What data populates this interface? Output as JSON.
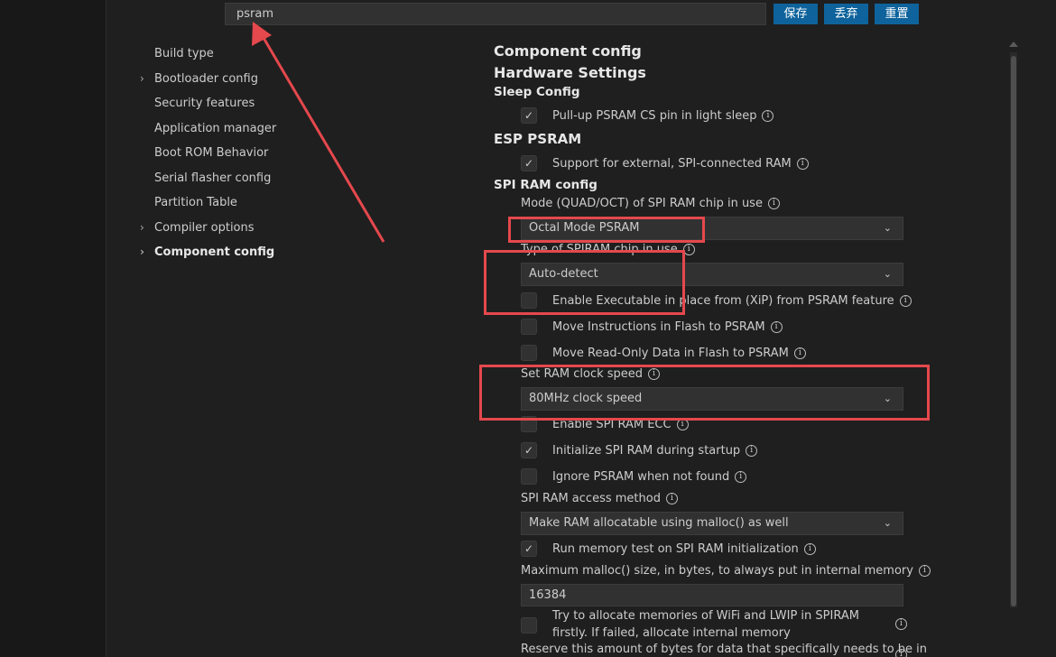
{
  "search": {
    "value": "psram"
  },
  "toolbar": {
    "save_label": "保存",
    "discard_label": "丢弃",
    "reset_label": "重置"
  },
  "nav": {
    "items": [
      {
        "label": "Build type",
        "expandable": false
      },
      {
        "label": "Bootloader config",
        "expandable": true
      },
      {
        "label": "Security features",
        "expandable": false
      },
      {
        "label": "Application manager",
        "expandable": false
      },
      {
        "label": "Boot ROM Behavior",
        "expandable": false
      },
      {
        "label": "Serial flasher config",
        "expandable": false
      },
      {
        "label": "Partition Table",
        "expandable": false
      },
      {
        "label": "Compiler options",
        "expandable": true
      },
      {
        "label": "Component config",
        "expandable": true,
        "active": true
      }
    ]
  },
  "content": {
    "component_config": "Component config",
    "hardware_settings": "Hardware Settings",
    "sleep_config": "Sleep Config",
    "pullup_cs": {
      "label": "Pull-up PSRAM CS pin in light sleep",
      "checked": true
    },
    "esp_psram": "ESP PSRAM",
    "support_external": {
      "label": "Support for external, SPI-connected RAM",
      "checked": true
    },
    "spi_ram_config": "SPI RAM config",
    "mode_label": "Mode (QUAD/OCT) of SPI RAM chip in use",
    "mode_value": "Octal Mode PSRAM",
    "type_label": "Type of SPIRAM chip in use",
    "type_value": "Auto-detect",
    "xip": {
      "label": "Enable Executable in place from (XiP) from PSRAM feature",
      "checked": false
    },
    "move_instr": {
      "label": "Move Instructions in Flash to PSRAM",
      "checked": false
    },
    "move_ro": {
      "label": "Move Read-Only Data in Flash to PSRAM",
      "checked": false
    },
    "clock_label": "Set RAM clock speed",
    "clock_value": "80MHz clock speed",
    "ecc": {
      "label": "Enable SPI RAM ECC",
      "checked": false
    },
    "init_startup": {
      "label": "Initialize SPI RAM during startup",
      "checked": true
    },
    "ignore_notfound": {
      "label": "Ignore PSRAM when not found",
      "checked": false
    },
    "access_label": "SPI RAM access method",
    "access_value": "Make RAM allocatable using malloc() as well",
    "memtest": {
      "label": "Run memory test on SPI RAM initialization",
      "checked": true
    },
    "malloc_label": "Maximum malloc() size, in bytes, to always put in internal memory",
    "malloc_value": "16384",
    "wifi_lwip": {
      "label": "Try to allocate memories of WiFi and LWIP in SPIRAM firstly. If failed, allocate internal memory",
      "checked": false
    },
    "reserve_label": "Reserve this amount of bytes for data that specifically needs to be in"
  },
  "glyphs": {
    "check": "✓",
    "info": "i",
    "chevron_right": "›",
    "chevron_down": "⌄"
  },
  "colors": {
    "annotation": "#e5484d",
    "button": "#0e639c",
    "background": "#1f1f1f"
  }
}
